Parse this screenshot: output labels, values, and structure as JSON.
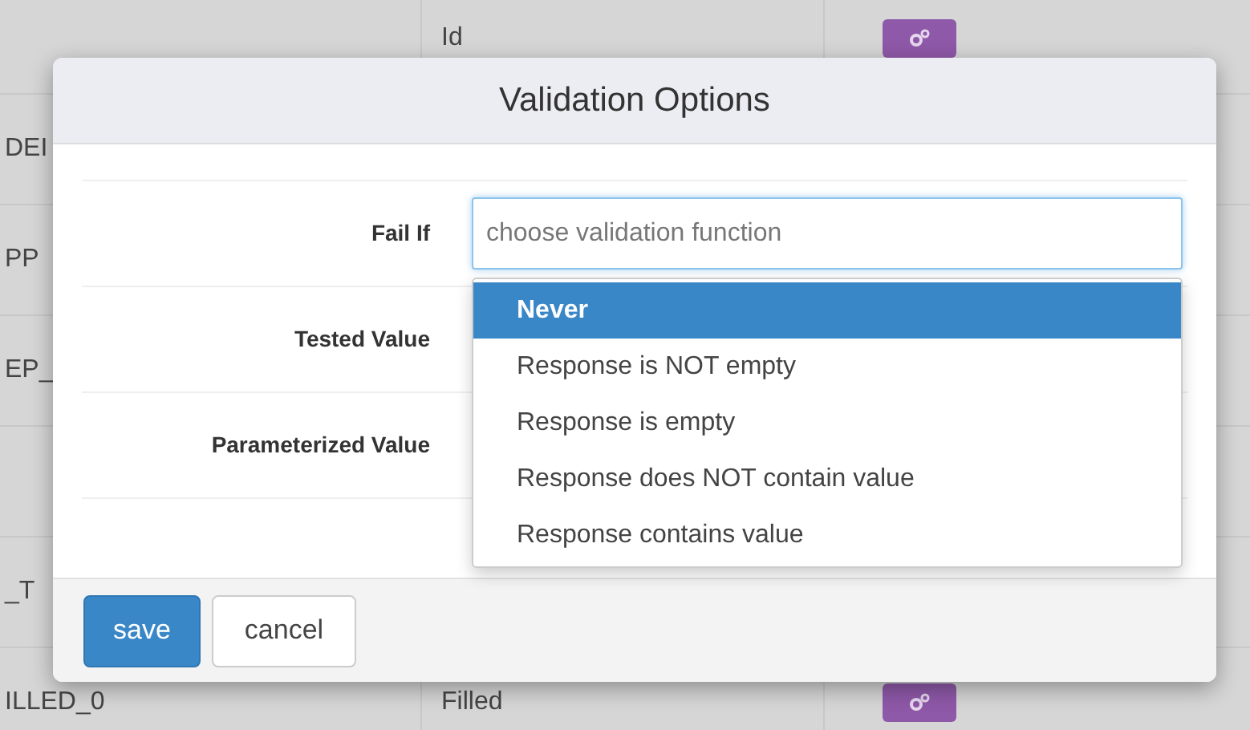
{
  "background_table": {
    "rows": [
      {
        "column_1": "",
        "column_2": "Id",
        "action_button": true
      },
      {
        "column_1": "DEI",
        "column_2": "",
        "action_button": false
      },
      {
        "column_1": "PP",
        "column_2": "",
        "action_button": false
      },
      {
        "column_1": "EP_",
        "column_2": "",
        "action_button": false
      },
      {
        "column_1": "",
        "column_2": "",
        "action_button": false
      },
      {
        "column_1": "_T",
        "column_2": "",
        "action_button": false
      },
      {
        "column_1": "ILLED_0",
        "column_2": "Filled",
        "action_button": true
      }
    ]
  },
  "dialog": {
    "title": "Validation Options",
    "fields": [
      {
        "label": "Fail If",
        "placeholder": "choose validation function",
        "expanded": true
      },
      {
        "label": "Tested Value"
      },
      {
        "label": "Parameterized Value"
      }
    ],
    "options": [
      {
        "label": "Never",
        "selected": true
      },
      {
        "label": "Response is NOT empty",
        "selected": false
      },
      {
        "label": "Response is empty",
        "selected": false
      },
      {
        "label": "Response does NOT contain value",
        "selected": false
      },
      {
        "label": "Response contains value",
        "selected": false
      }
    ],
    "buttons": [
      {
        "label": "save",
        "kind": "primary"
      },
      {
        "label": "cancel",
        "kind": "default"
      }
    ]
  }
}
